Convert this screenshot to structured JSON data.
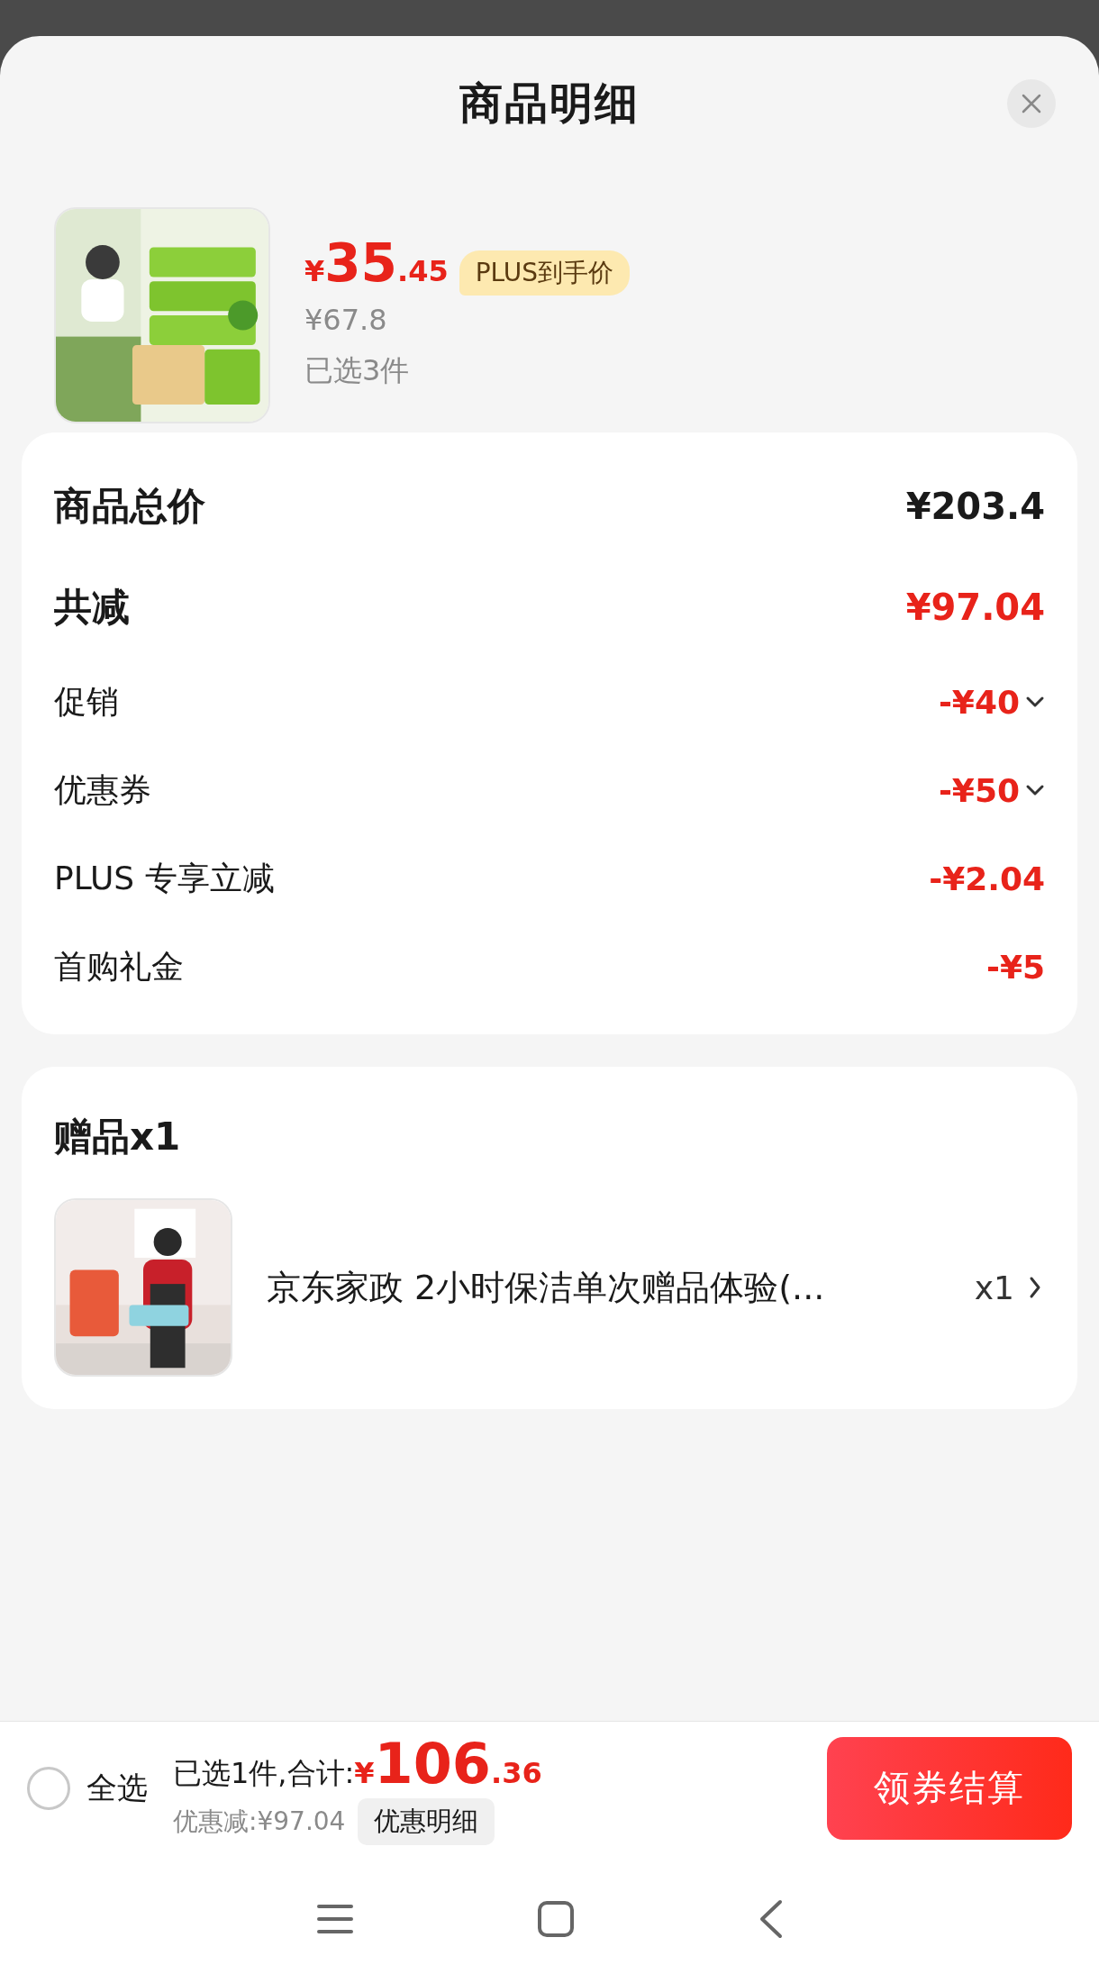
{
  "sheet": {
    "title": "商品明细"
  },
  "product": {
    "price": {
      "currency": "¥",
      "integer": "35",
      "decimal": ".45"
    },
    "badge": "PLUS到手价",
    "original_price": "¥67.8",
    "selected_count": "已选3件"
  },
  "summary": {
    "rows": [
      {
        "kind": "total",
        "label": "商品总价",
        "value": "¥203.4"
      },
      {
        "kind": "reduction-total",
        "label": "共减",
        "value": "¥97.04"
      },
      {
        "kind": "dropdown",
        "label": "促销",
        "value": "-¥40"
      },
      {
        "kind": "dropdown",
        "label": "优惠券",
        "value": "-¥50"
      },
      {
        "kind": "plain",
        "label": "PLUS 专享立减",
        "value": "-¥2.04"
      },
      {
        "kind": "plain",
        "label": "首购礼金",
        "value": "-¥5"
      }
    ]
  },
  "gifts": {
    "title": "赠品x1",
    "items": [
      {
        "name": "京东家政 2小时保洁单次赠品体验(...",
        "quantity": "x1"
      }
    ]
  },
  "footer": {
    "select_all": {
      "label": "全选",
      "checked": false
    },
    "total_label": "已选1件,合计:",
    "total": {
      "currency": "¥",
      "integer": "106",
      "decimal": ".36"
    },
    "discount": "优惠减:¥97.04",
    "details_button": "优惠明细",
    "checkout_button": "领券结算"
  }
}
